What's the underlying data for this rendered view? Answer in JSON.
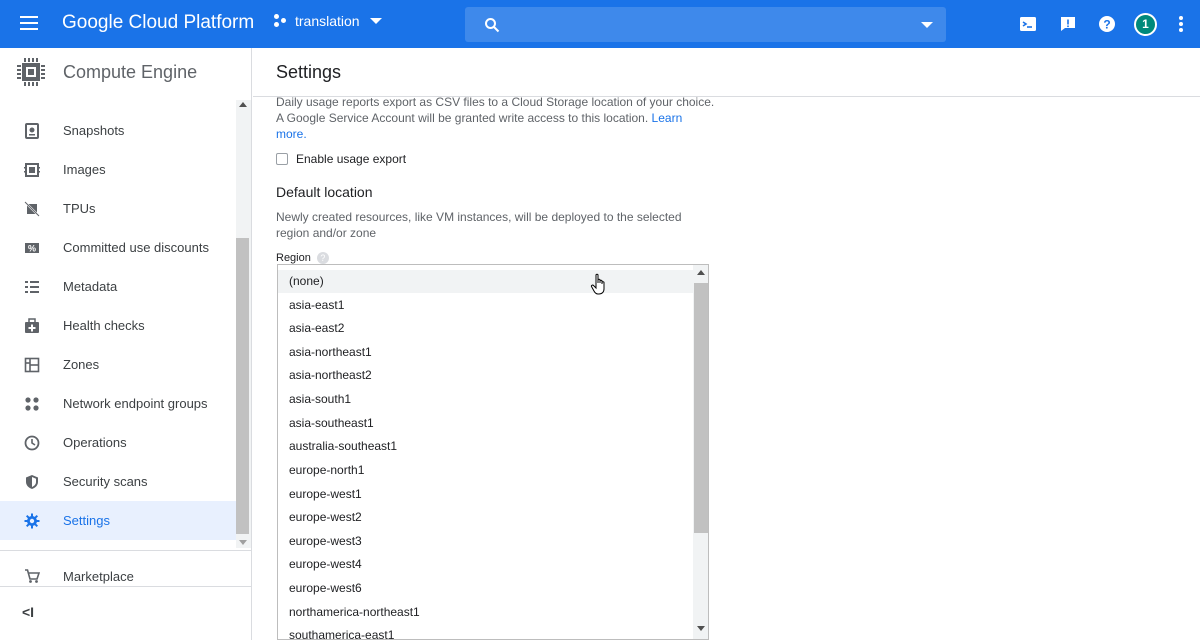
{
  "header": {
    "brand": "Google Cloud Platform",
    "project": "translation",
    "search_placeholder": "",
    "avatar_count": "1",
    "icons": [
      "menu-icon",
      "project-icon",
      "search-icon",
      "cloud-shell-icon",
      "feedback-icon",
      "help-icon",
      "more-vert-icon"
    ],
    "color": "#1a73e8"
  },
  "sidebar": {
    "title": "Compute Engine",
    "items": [
      {
        "label": "Snapshots",
        "icon": "snapshot-icon"
      },
      {
        "label": "Images",
        "icon": "images-icon"
      },
      {
        "label": "TPUs",
        "icon": "tpu-icon"
      },
      {
        "label": "Committed use discounts",
        "icon": "percent-icon"
      },
      {
        "label": "Metadata",
        "icon": "metadata-icon"
      },
      {
        "label": "Health checks",
        "icon": "health-icon"
      },
      {
        "label": "Zones",
        "icon": "zones-icon"
      },
      {
        "label": "Network endpoint groups",
        "icon": "network-icon"
      },
      {
        "label": "Operations",
        "icon": "clock-icon"
      },
      {
        "label": "Security scans",
        "icon": "shield-icon"
      },
      {
        "label": "Settings",
        "icon": "gear-icon",
        "active": true
      }
    ],
    "marketplace": "Marketplace",
    "collapse": "<I"
  },
  "main": {
    "title": "Settings",
    "usage_desc_line1": "Daily usage reports export as CSV files to a Cloud Storage location of your choice.",
    "usage_desc_line2": "A Google Service Account will be granted write access to this location.",
    "learn_more": "Learn more.",
    "enable_usage_export": "Enable usage export",
    "default_location_title": "Default location",
    "default_location_desc": "Newly created resources, like VM instances, will be deployed to the selected region and/or zone",
    "region_label": "Region",
    "region_options": [
      "(none)",
      "asia-east1",
      "asia-east2",
      "asia-northeast1",
      "asia-northeast2",
      "asia-south1",
      "asia-southeast1",
      "australia-southeast1",
      "europe-north1",
      "europe-west1",
      "europe-west2",
      "europe-west3",
      "europe-west4",
      "europe-west6",
      "northamerica-northeast1",
      "southamerica-east1"
    ]
  }
}
